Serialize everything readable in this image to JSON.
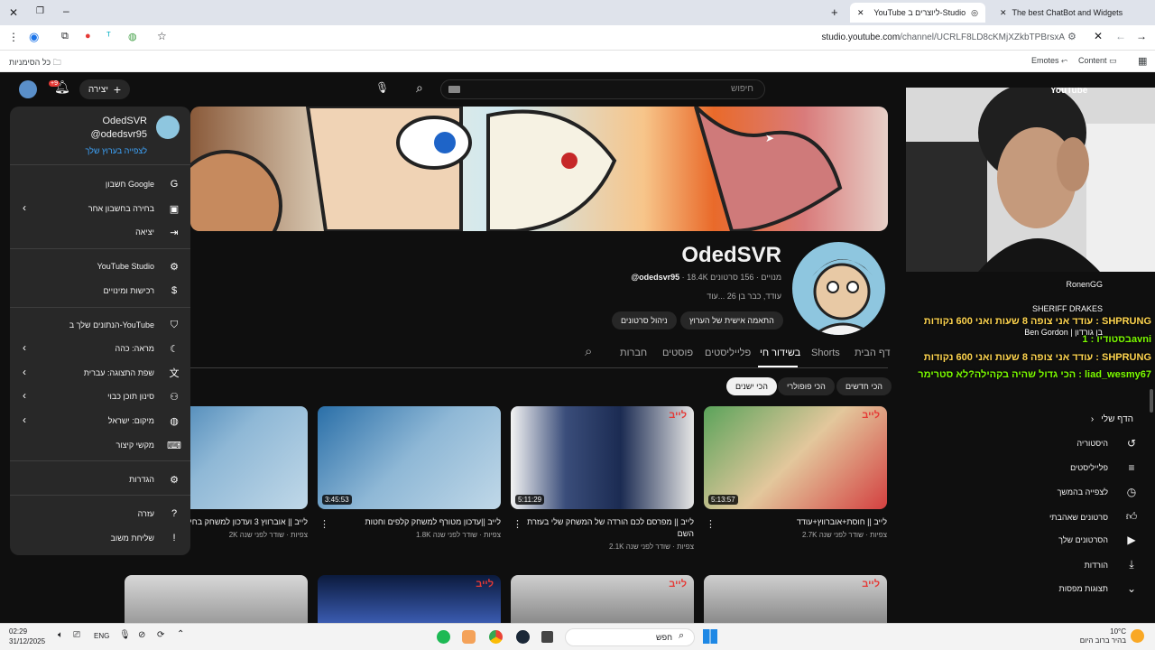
{
  "browser": {
    "tabs": [
      {
        "title": "The best ChatBot and Widgets"
      },
      {
        "title": "YouTube ליוצרים ב-Studio"
      }
    ],
    "url_host": "studio.youtube.com",
    "url_path": "/channel/UCRLF8LD8cKMjXZkbTPBrsxA",
    "bookmarks": {
      "all": "כל הסימניות",
      "emotes": "Emotes",
      "content": "Content"
    }
  },
  "youtube": {
    "search_placeholder": "חיפוש",
    "create_label": "יצירה",
    "notif_badge": "+9",
    "channel": {
      "name": "OdedSVR",
      "handle": "@odedsvr95",
      "subs": "18.4K מנויים",
      "videos": "156 סרטונים",
      "about": "עודד, כבר בן 26 ...עוד",
      "customize_btn": "התאמה אישית של הערוץ",
      "manage_btn": "ניהול סרטונים"
    },
    "tabs": [
      "דף הבית",
      "Shorts",
      "בשידור חי",
      "פלייליסטים",
      "פוסטים",
      "חברות"
    ],
    "filters": [
      "הכי חדשים",
      "הכי פופולרי",
      "הכי ישנים"
    ],
    "videos": [
      {
        "title": "לייב || חוסת+אוברווץ+עודד",
        "views": "2.7K צפיות",
        "ago": "שודר לפני שנה",
        "dur": "5:13:57"
      },
      {
        "title": "לייב || מפרסם לכם הורדה של המשחק שלי בעזרת השם",
        "views": "2.1K צפיות",
        "ago": "שודר לפני שנה",
        "dur": "5:11:29"
      },
      {
        "title": "לייב ||עדכון מטורף למשחק קלפים וחטות",
        "views": "1.8K צפיות",
        "ago": "שודר לפני שנה",
        "dur": "3:45:53"
      },
      {
        "title": "לייב || אוברווץ 3 ועדכון למשחק בחינם",
        "views": "2K צפיות",
        "ago": "שודר לפני שנה",
        "dur": ""
      }
    ],
    "live_badge": "לייב"
  },
  "account_menu": {
    "name": "OdedSVR",
    "handle": "@odedsvr95",
    "view_channel": "לצפייה בערוץ שלך",
    "items": [
      {
        "label": "חשבון Google",
        "icon": "google-icon",
        "chevron": false
      },
      {
        "label": "בחירה בחשבון אחר",
        "icon": "switch-account-icon",
        "chevron": true
      },
      {
        "label": "יציאה",
        "icon": "sign-out-icon",
        "chevron": false
      },
      {
        "label": "YouTube Studio",
        "icon": "studio-icon",
        "chevron": false
      },
      {
        "label": "רכישות ומינויים",
        "icon": "dollar-icon",
        "chevron": false
      },
      {
        "label": "הנתונים שלך ב-YouTube",
        "icon": "shield-icon",
        "chevron": false
      },
      {
        "label": "מראה: כהה",
        "icon": "moon-icon",
        "chevron": true
      },
      {
        "label": "שפת התצוגה: עברית",
        "icon": "translate-icon",
        "chevron": true
      },
      {
        "label": "סינון תוכן כבוי",
        "icon": "restricted-icon",
        "chevron": true
      },
      {
        "label": "מיקום: ישראל",
        "icon": "globe-icon",
        "chevron": true
      },
      {
        "label": "מקשי קיצור",
        "icon": "keyboard-icon",
        "chevron": false
      },
      {
        "label": "הגדרות",
        "icon": "gear-icon",
        "chevron": false
      },
      {
        "label": "עזרה",
        "icon": "help-icon",
        "chevron": false
      },
      {
        "label": "שליחת משוב",
        "icon": "feedback-icon",
        "chevron": false
      }
    ]
  },
  "chat": [
    {
      "text": "RonenGG",
      "color": "#ffffff"
    },
    {
      "text": "SHERIFF DRAKES",
      "color": "#ffffff"
    },
    {
      "text": "עודד אני צופה 8 שעות ואני 600 נקודות : SHPRUNG",
      "color": "#ffd54f"
    },
    {
      "text": "Ben Gordon | בן גורדון",
      "color": "#ffffff"
    },
    {
      "text": "בסטודיו : 1avni",
      "color": "#7cfc00"
    },
    {
      "text": "עודד אני צופה 8 שעות ואני 600 נקודות : SHPRUNG",
      "color": "#ffd54f"
    },
    {
      "text": "הכי גדול שהיה בקהילה?לא סטרימר : liad_wesmy67",
      "color": "#7cfc00"
    }
  ],
  "right_sidebar": {
    "header": "הדף שלי",
    "items": [
      {
        "label": "היסטוריה",
        "icon": "history-icon"
      },
      {
        "label": "פלייליסטים",
        "icon": "playlist-icon"
      },
      {
        "label": "לצפייה בהמשך",
        "icon": "clock-icon"
      },
      {
        "label": "סרטונים שאהבתי",
        "icon": "thumbs-up-icon"
      },
      {
        "label": "הסרטונים שלך",
        "icon": "video-icon"
      },
      {
        "label": "הורדות",
        "icon": "download-icon"
      },
      {
        "label": "תצוגות מפסות",
        "icon": "chevron-down-icon"
      }
    ],
    "youtube_logo": "YouTube"
  },
  "taskbar": {
    "time": "02:29",
    "date": "31/12/2025",
    "lang": "ENG",
    "search": "חפש",
    "weather": "10°C",
    "weather_desc": "בהיר ברוב היום"
  }
}
